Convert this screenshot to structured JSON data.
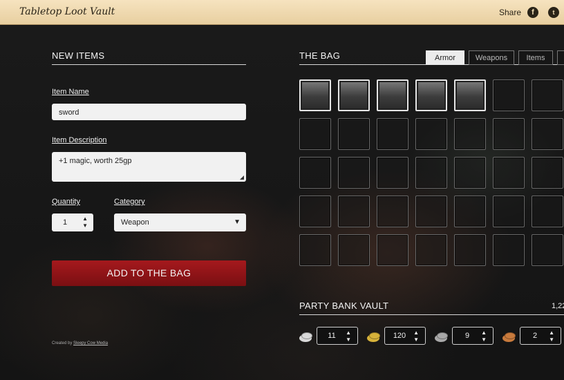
{
  "header": {
    "app_title": "Tabletop Loot Vault",
    "share_label": "Share",
    "facebook_glyph": "f",
    "twitter_glyph": "t"
  },
  "new_items": {
    "title": "NEW ITEMS",
    "item_name_label": "Item Name",
    "item_name_value": "sword",
    "item_description_label": "Item Description",
    "item_description_value": "+1 magic, worth 25gp",
    "quantity_label": "Quantity",
    "quantity_value": "1",
    "category_label": "Category",
    "category_value": "Weapon",
    "add_button_label": "ADD TO THE BAG",
    "credit_prefix": "Created by",
    "credit_link": "Sleepy Cow Media"
  },
  "bag": {
    "title": "THE BAG",
    "tabs": [
      {
        "label": "Armor",
        "active": true
      },
      {
        "label": "Weapons",
        "active": false
      },
      {
        "label": "Items",
        "active": false
      },
      {
        "label": "",
        "active": false
      }
    ],
    "filled_slots": 5,
    "rows": 5,
    "cols_visible": 7
  },
  "vault": {
    "title": "PARTY BANK VAULT",
    "total": "1,22",
    "coins": [
      {
        "name": "platinum",
        "color": "#d9d9d9",
        "value": "11"
      },
      {
        "name": "gold",
        "color": "#d7b23a",
        "value": "120"
      },
      {
        "name": "silver",
        "color": "#a9a9a9",
        "value": "9"
      },
      {
        "name": "copper",
        "color": "#c87a3c",
        "value": "2"
      }
    ]
  },
  "icons": {
    "up_arrow": "▲",
    "down_arrow": "▼",
    "select_arrow": "▼"
  }
}
